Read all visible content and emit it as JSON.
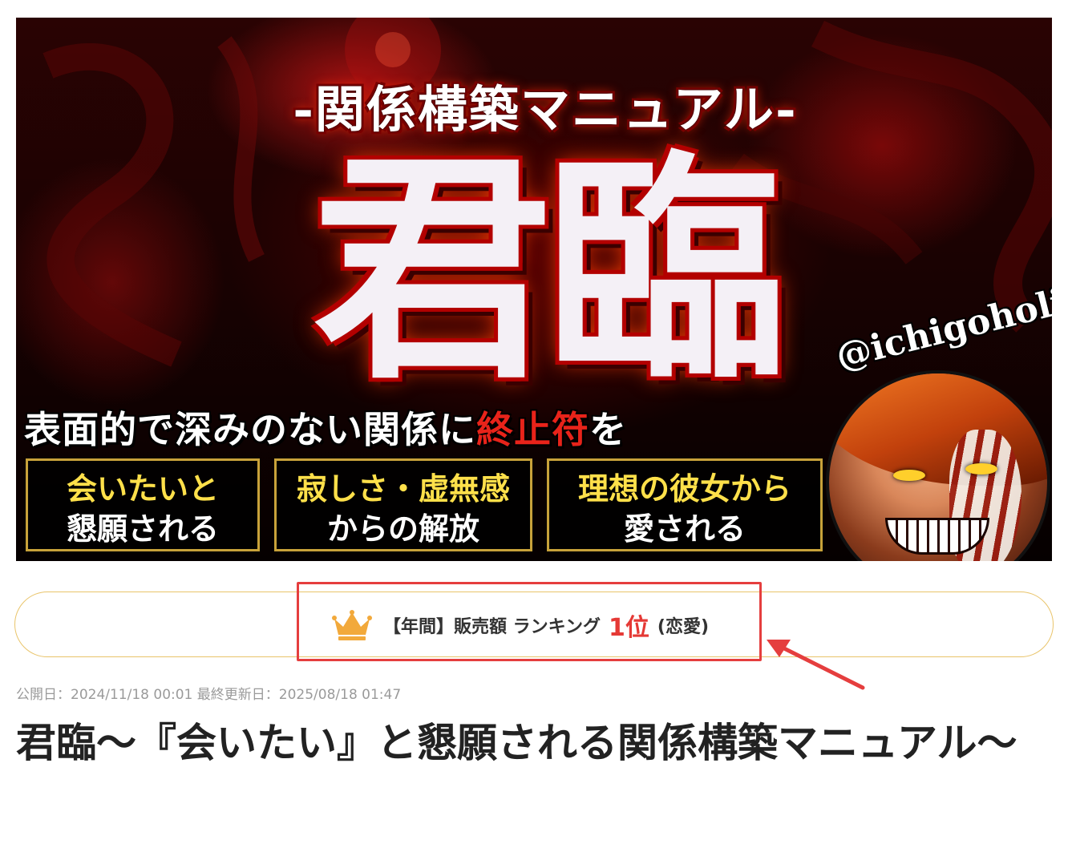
{
  "hero": {
    "subtitle": "-関係構築マニュアル-",
    "title": "君臨",
    "tagline_main": "表面的で深みのない関係に",
    "tagline_red": "終止符",
    "tagline_end": "を",
    "features": [
      {
        "line1": "会いたいと",
        "line2": "懇願される"
      },
      {
        "line1": "寂しさ・虚無感",
        "line2": "からの解放"
      },
      {
        "line1": "理想の彼女から",
        "line2": "愛される"
      }
    ],
    "handle": "@ichigoholi",
    "colors": {
      "accent_red": "#e8231a",
      "gold": "#ffe04a",
      "border_gold": "#c8a23a"
    }
  },
  "ranking": {
    "icon": "crown-icon",
    "label": "【年間】販売額 ランキング",
    "rank": "1位",
    "category": "(恋愛)",
    "colors": {
      "crown": "#f2a93b",
      "rank": "#e53935",
      "border": "#e9c46a",
      "highlight": "#e53e3e"
    }
  },
  "meta": {
    "published": "公開日：2024/11/18 00:01 最終更新日：2025/08/18 01:47"
  },
  "title": "君臨〜『会いたい』と懇願される関係構築マニュアル〜"
}
